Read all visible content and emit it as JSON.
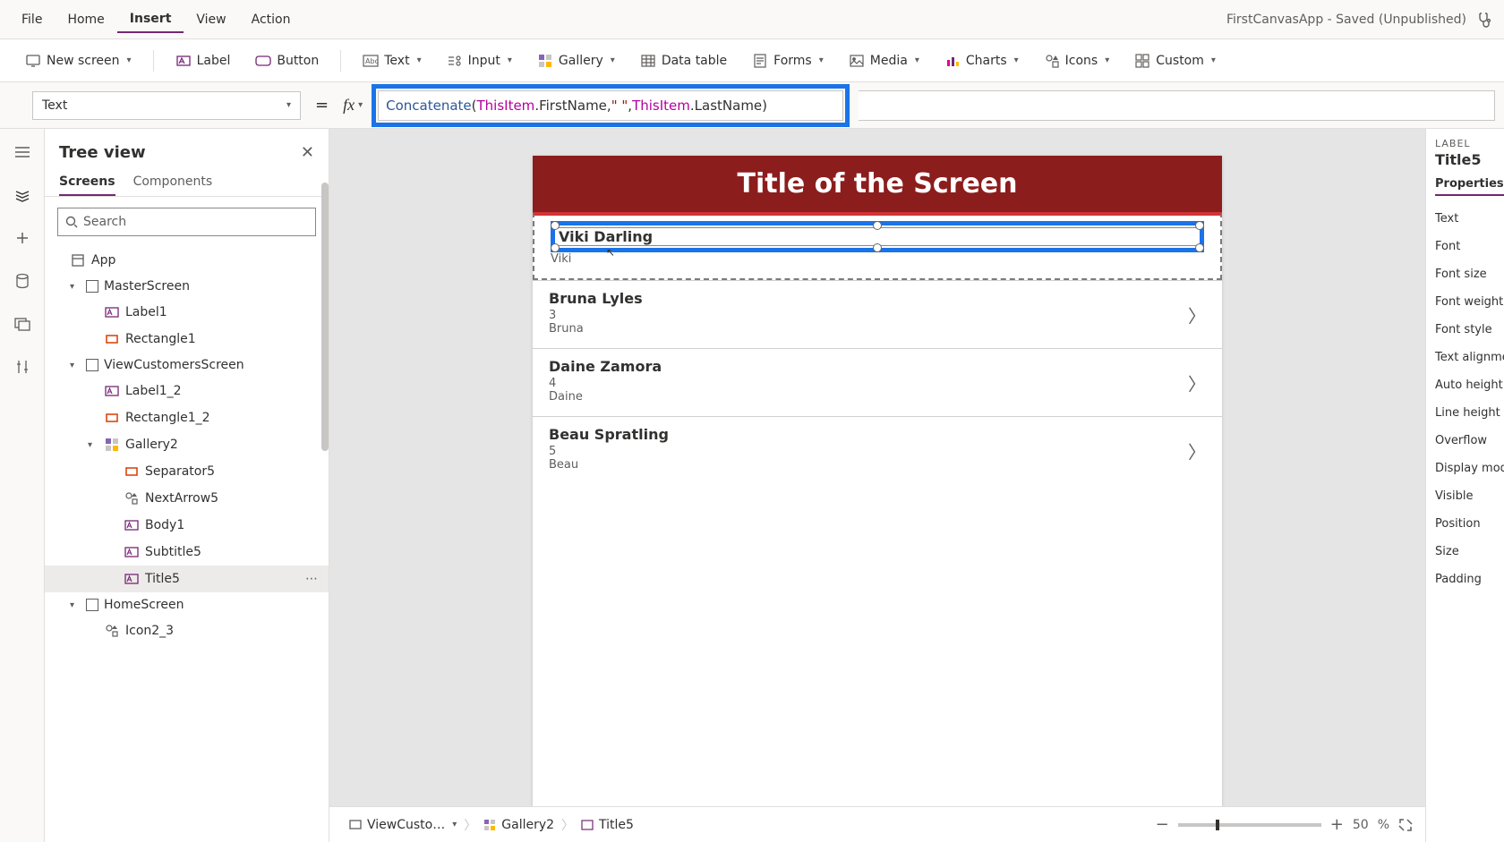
{
  "menubar": {
    "items": [
      "File",
      "Home",
      "Insert",
      "View",
      "Action"
    ],
    "active": "Insert",
    "app_title": "FirstCanvasApp - Saved (Unpublished)"
  },
  "ribbon": {
    "new_screen": "New screen",
    "label": "Label",
    "button": "Button",
    "text": "Text",
    "input": "Input",
    "gallery": "Gallery",
    "data_table": "Data table",
    "forms": "Forms",
    "media": "Media",
    "charts": "Charts",
    "icons": "Icons",
    "custom": "Custom"
  },
  "formula": {
    "property": "Text",
    "tokens": {
      "fn": "Concatenate",
      "open": "(",
      "obj1": "ThisItem",
      "dot": ".",
      "p1": "FirstName",
      "comma1": ", ",
      "str": "\" \"",
      "comma2": ", ",
      "obj2": "ThisItem",
      "p2": "LastName",
      "close": ")"
    }
  },
  "tree": {
    "title": "Tree view",
    "tabs": {
      "screens": "Screens",
      "components": "Components"
    },
    "search_placeholder": "Search",
    "items": [
      {
        "label": "App",
        "icon": "app"
      },
      {
        "label": "MasterScreen",
        "icon": "screen",
        "ind": "ind1",
        "twist": "▾",
        "box": true
      },
      {
        "label": "Label1",
        "icon": "label",
        "ind": "ind2"
      },
      {
        "label": "Rectangle1",
        "icon": "rect",
        "ind": "ind2"
      },
      {
        "label": "ViewCustomersScreen",
        "icon": "screen",
        "ind": "ind1",
        "twist": "▾",
        "box": true
      },
      {
        "label": "Label1_2",
        "icon": "label",
        "ind": "ind2"
      },
      {
        "label": "Rectangle1_2",
        "icon": "rect",
        "ind": "ind2"
      },
      {
        "label": "Gallery2",
        "icon": "gallery",
        "ind": "ind2",
        "twist": "▾"
      },
      {
        "label": "Separator5",
        "icon": "rect",
        "ind": "ind3"
      },
      {
        "label": "NextArrow5",
        "icon": "iconctl",
        "ind": "ind3"
      },
      {
        "label": "Body1",
        "icon": "label",
        "ind": "ind3"
      },
      {
        "label": "Subtitle5",
        "icon": "label",
        "ind": "ind3"
      },
      {
        "label": "Title5",
        "icon": "label",
        "ind": "ind3",
        "selected": true,
        "dots": true
      },
      {
        "label": "HomeScreen",
        "icon": "screen",
        "ind": "ind1",
        "twist": "▾",
        "box": true
      },
      {
        "label": "Icon2_3",
        "icon": "iconctl",
        "ind": "ind2"
      }
    ]
  },
  "canvas": {
    "screen_title": "Title of the Screen",
    "items": [
      {
        "title": "Viki  Darling",
        "sub": "",
        "body": "Viki",
        "selected": true,
        "show_arrow": false
      },
      {
        "title": "Bruna  Lyles",
        "sub": "3",
        "body": "Bruna",
        "show_arrow": true
      },
      {
        "title": "Daine  Zamora",
        "sub": "4",
        "body": "Daine",
        "show_arrow": true
      },
      {
        "title": "Beau  Spratling",
        "sub": "5",
        "body": "Beau",
        "show_arrow": true
      }
    ]
  },
  "breadcrumb": {
    "items": [
      "ViewCusto…",
      "Gallery2",
      "Title5"
    ]
  },
  "zoom": {
    "value": "50",
    "pct": "%"
  },
  "props": {
    "kind": "LABEL",
    "name": "Title5",
    "tab": "Properties",
    "rows": [
      "Text",
      "Font",
      "Font size",
      "Font weight",
      "Font style",
      "Text alignme",
      "Auto height",
      "Line height",
      "Overflow",
      "Display mod",
      "Visible",
      "Position",
      "Size",
      "Padding"
    ]
  }
}
